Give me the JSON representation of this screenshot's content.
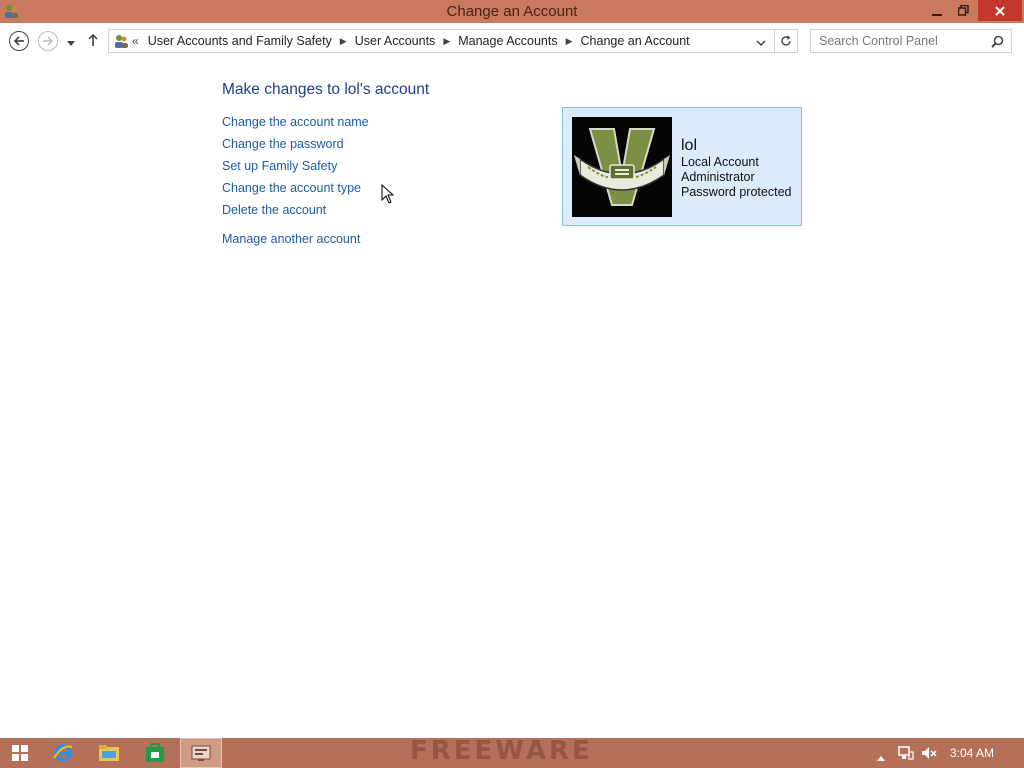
{
  "window": {
    "title": "Change an Account",
    "minimize_icon": "minimize-icon",
    "maximize_icon": "restore-icon",
    "close_icon": "close-icon"
  },
  "nav": {
    "address_lead": "«",
    "breadcrumbs": [
      "User Accounts and Family Safety",
      "User Accounts",
      "Manage Accounts",
      "Change an Account"
    ],
    "search_placeholder": "Search Control Panel"
  },
  "main": {
    "heading": "Make changes to lol's account",
    "links": [
      "Change the account name",
      "Change the password",
      "Set up Family Safety",
      "Change the account type",
      "Delete the account"
    ],
    "manage_other": "Manage another account"
  },
  "account": {
    "name": "lol",
    "type": "Local Account",
    "role": "Administrator",
    "protection": "Password protected"
  },
  "taskbar": {
    "watermark": "FREEWARE",
    "clock": "3:04 AM"
  },
  "colors": {
    "titlebar": "#c97a5e",
    "taskbar": "#b5705a",
    "link": "#1e5aa8",
    "heading": "#1e3f8a",
    "card_bg": "#dcebfa",
    "card_border": "#84c0ea"
  }
}
